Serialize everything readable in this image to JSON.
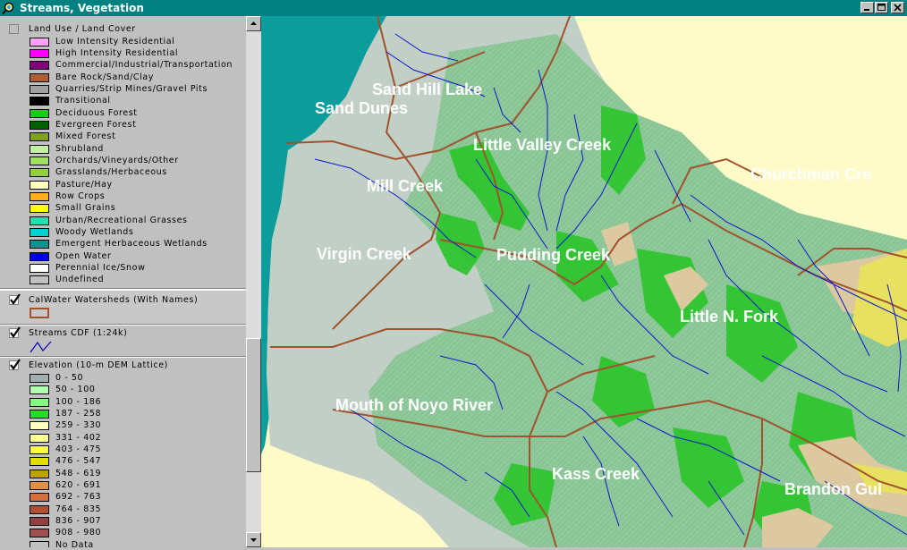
{
  "window": {
    "title": "Streams, Vegetation"
  },
  "legend": {
    "themes": [
      {
        "name": "Land Use / Land Cover",
        "checked": false,
        "items": [
          {
            "label": "Low Intensity Residential",
            "color": "#ffa0ff"
          },
          {
            "label": "High Intensity Residential",
            "color": "#ff00ff"
          },
          {
            "label": "Commercial/Industrial/Transportation",
            "color": "#800080"
          },
          {
            "label": "Bare Rock/Sand/Clay",
            "color": "#b06030"
          },
          {
            "label": "Quarries/Strip Mines/Gravel Pits",
            "color": "#a0a0a0"
          },
          {
            "label": "Transitional",
            "color": "#000000"
          },
          {
            "label": "Deciduous Forest",
            "color": "#10d010"
          },
          {
            "label": "Evergreen Forest",
            "color": "#006000"
          },
          {
            "label": "Mixed Forest",
            "color": "#80a020"
          },
          {
            "label": "Shrubland",
            "color": "#c0f0a0"
          },
          {
            "label": "Orchards/Vineyards/Other",
            "color": "#a0e060"
          },
          {
            "label": "Grasslands/Herbaceous",
            "color": "#90d040"
          },
          {
            "label": "Pasture/Hay",
            "color": "#ffffc0"
          },
          {
            "label": "Row Crops",
            "color": "#ffb020"
          },
          {
            "label": "Small Grains",
            "color": "#ffff00"
          },
          {
            "label": "Urban/Recreational Grasses",
            "color": "#20e0b0"
          },
          {
            "label": "Woody Wetlands",
            "color": "#00d0d0"
          },
          {
            "label": "Emergent Herbaceous Wetlands",
            "color": "#109090"
          },
          {
            "label": "Open Water",
            "color": "#0000e0"
          },
          {
            "label": "Perennial Ice/Snow",
            "color": "#ffffff"
          },
          {
            "label": "Undefined",
            "color": "#c0c0c0"
          }
        ]
      },
      {
        "name": "CalWater Watersheds (With Names)",
        "checked": true,
        "symbol_color": "#a0522d"
      },
      {
        "name": "Streams CDF (1:24k)",
        "checked": true,
        "symbol_color": "#0000c0"
      },
      {
        "name": "Elevation (10-m DEM Lattice)",
        "checked": true,
        "items": [
          {
            "label": "0 - 50",
            "color": "#a0b0b0"
          },
          {
            "label": "50 - 100",
            "color": "#b0ffb0"
          },
          {
            "label": "100 - 186",
            "color": "#80ff80"
          },
          {
            "label": "187 - 258",
            "color": "#20e020"
          },
          {
            "label": "259 - 330",
            "color": "#ffffc0"
          },
          {
            "label": "331 - 402",
            "color": "#ffff90"
          },
          {
            "label": "403 - 475",
            "color": "#ffff40"
          },
          {
            "label": "476 - 547",
            "color": "#e0e000"
          },
          {
            "label": "548 - 619",
            "color": "#c0a000"
          },
          {
            "label": "620 - 691",
            "color": "#e09040"
          },
          {
            "label": "692 - 763",
            "color": "#d07040"
          },
          {
            "label": "764 - 835",
            "color": "#b05030"
          },
          {
            "label": "836 - 907",
            "color": "#904040"
          },
          {
            "label": "908 - 980",
            "color": "#a05050"
          },
          {
            "label": "No Data",
            "color": "#c0c0c0"
          }
        ]
      }
    ]
  },
  "map": {
    "labels": [
      "Sand Hill Lake",
      "Sand Dunes",
      "Little Valley Creek",
      "Churchman Cre",
      "Mill Creek",
      "Virgin Creek",
      "Pudding Creek",
      "Little N. Fork",
      "Mouth of Noyo River",
      "Kass Creek",
      "Brandon Gul"
    ],
    "colors": {
      "ocean": "#0c9c9c",
      "land_beyond": "#fffbc8",
      "terrace": "#c2cfc6",
      "forest": "#8fc89a",
      "ridge_green": "#2bc52b",
      "high_tan": "#ddc9a0",
      "high_yellow": "#e8e060",
      "stream": "#0818d0",
      "watershed": "#a0522d"
    }
  }
}
